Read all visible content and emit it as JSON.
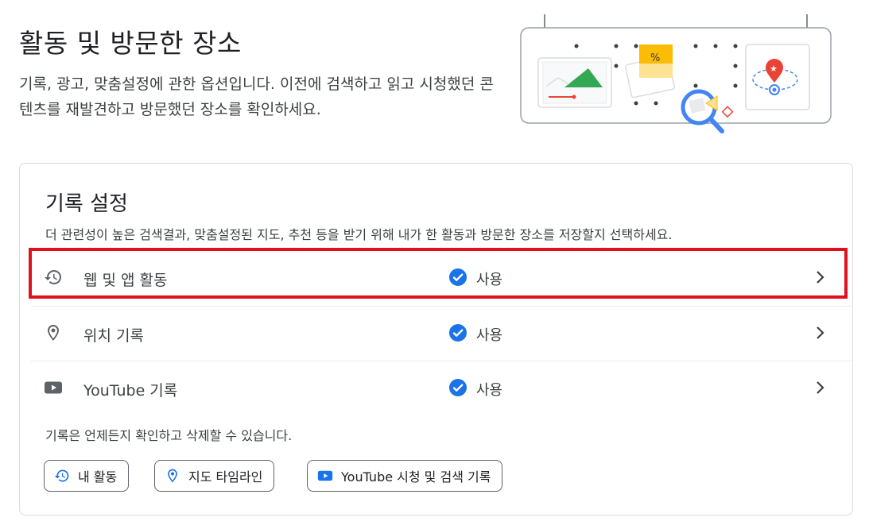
{
  "header": {
    "title": "활동 및 방문한 장소",
    "description": "기록, 광고, 맞춤설정에 관한 옵션입니다. 이전에 검색하고 읽고 시청했던 콘텐츠를 재발견하고 방문했던 장소를 확인하세요."
  },
  "settings_card": {
    "title": "기록 설정",
    "description": "더 관련성이 높은 검색결과, 맞춤설정된 지도, 추천 등을 받기 위해 내가 한 활동과 방문한 장소를 저장할지 선택하세요.",
    "rows": [
      {
        "label": "웹 및 앱 활동",
        "status": "사용",
        "icon": "history-icon",
        "highlighted": true
      },
      {
        "label": "위치 기록",
        "status": "사용",
        "icon": "location-pin-icon"
      },
      {
        "label": "YouTube 기록",
        "status": "사용",
        "icon": "youtube-icon"
      }
    ],
    "footer_note": "기록은 언제든지 확인하고 삭제할 수 있습니다.",
    "chips": [
      {
        "label": "내 활동",
        "icon": "history-icon"
      },
      {
        "label": "지도 타임라인",
        "icon": "location-pin-icon"
      },
      {
        "label": "YouTube 시청 및 검색 기록",
        "icon": "youtube-icon"
      }
    ]
  },
  "colors": {
    "check_blue": "#1a73e8",
    "highlight_red": "#e0111f",
    "icon_gray": "#5f6368"
  }
}
